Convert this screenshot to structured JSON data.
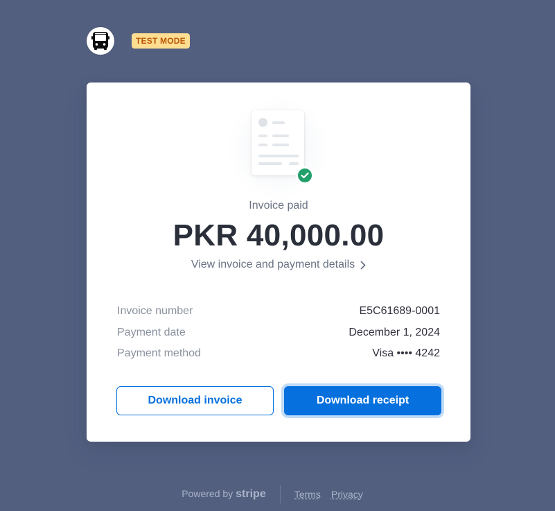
{
  "header": {
    "logo_icon": "bus-icon",
    "badge": "TEST MODE"
  },
  "invoice": {
    "status": "Invoice paid",
    "amount": "PKR 40,000.00",
    "details_link": "View invoice and payment details",
    "rows": [
      {
        "label": "Invoice number",
        "value": "E5C61689-0001"
      },
      {
        "label": "Payment date",
        "value": "December 1, 2024"
      },
      {
        "label": "Payment method",
        "value": "Visa •••• 4242"
      }
    ]
  },
  "actions": {
    "download_invoice": "Download invoice",
    "download_receipt": "Download receipt"
  },
  "footer": {
    "powered_by": "Powered by",
    "brand": "stripe",
    "terms": "Terms",
    "privacy": "Privacy"
  },
  "colors": {
    "background": "#525f7f",
    "accent": "#0570de",
    "success": "#22a06b",
    "badge_bg": "#ffde92",
    "badge_text": "#bb5504"
  }
}
